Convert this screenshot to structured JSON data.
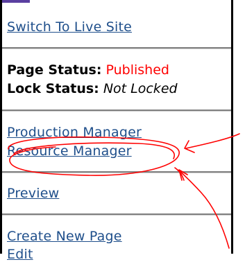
{
  "nav": {
    "switch_live": "Switch To Live Site",
    "production_manager": "Production Manager",
    "resource_manager": "Resource Manager",
    "preview": "Preview",
    "create_new_page": "Create New Page",
    "edit_partial": "Edit"
  },
  "status": {
    "page_label": "Page Status:",
    "page_value": "Published",
    "lock_label": "Lock Status:",
    "lock_value": "Not Locked"
  },
  "annotation": {
    "color": "#ff0000",
    "shape": "hand-drawn circle with arrows pointing to Resource Manager"
  }
}
